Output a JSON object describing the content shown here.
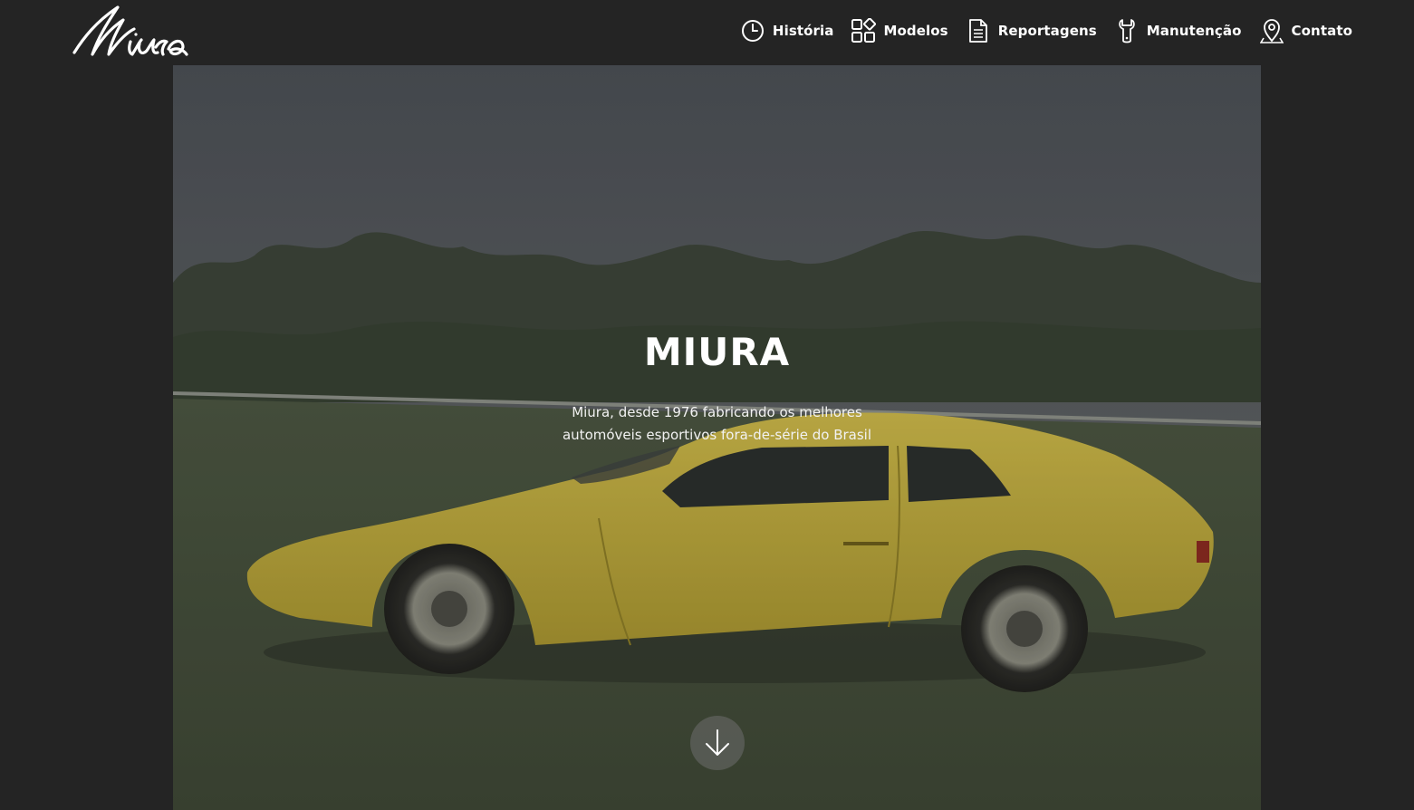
{
  "brand": {
    "logo_text": "Miura",
    "icon": "miura-script-logo"
  },
  "nav": {
    "items": [
      {
        "label": "História",
        "icon": "clock-icon"
      },
      {
        "label": "Modelos",
        "icon": "grid-icon"
      },
      {
        "label": "Reportagens",
        "icon": "document-icon"
      },
      {
        "label": "Manutenção",
        "icon": "wrench-icon"
      },
      {
        "label": "Contato",
        "icon": "location-pin-icon"
      }
    ]
  },
  "hero": {
    "title": "MIURA",
    "subtitle_line1": "Miura, desde 1976 fabricando os melhores",
    "subtitle_line2": "automóveis esportivos fora-de-série do Brasil",
    "scroll_icon": "arrow-down-icon",
    "image": "yellow-miura-sports-car-on-grass"
  },
  "colors": {
    "background": "#242424",
    "text": "#ffffff",
    "car": "#c8b23c"
  }
}
